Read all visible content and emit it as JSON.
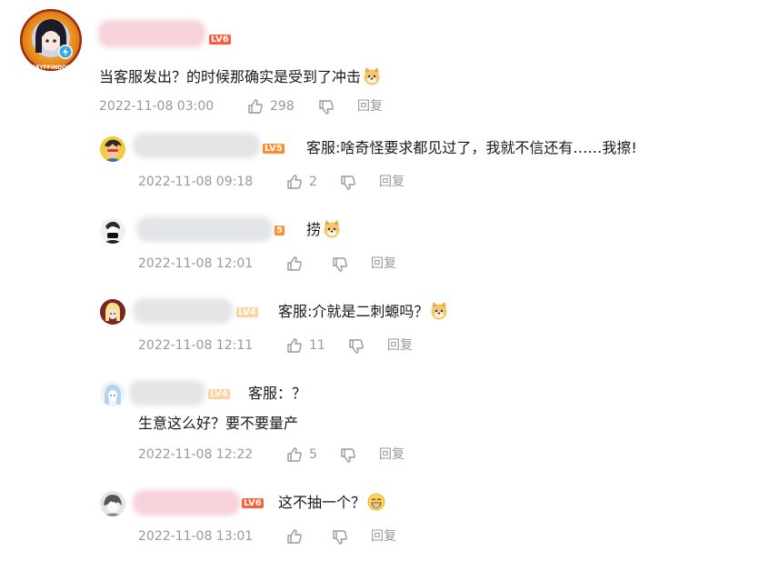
{
  "main_comment": {
    "level_badge": "LV6",
    "badge_text": "GRYFFINDOR",
    "text": "当客服发出？的时候那确实是受到了冲击",
    "emoji": "doge-emoji",
    "time": "2022-11-08 03:00",
    "likes": "298",
    "reply_label": "回复"
  },
  "replies": [
    {
      "level_badge": "LV5",
      "text": "客服:啥奇怪要求都见过了，我就不信还有……我擦!",
      "text2": "",
      "emoji": "",
      "time": "2022-11-08 09:18",
      "likes": "2",
      "reply_label": "回复"
    },
    {
      "level_badge": "5",
      "text": "捞",
      "text2": "",
      "emoji": "doge-emoji",
      "time": "2022-11-08 12:01",
      "likes": "",
      "reply_label": "回复"
    },
    {
      "level_badge": "LV4",
      "text": "客服:介就是二刺螈吗？",
      "text2": "",
      "emoji": "doge-emoji",
      "time": "2022-11-08 12:11",
      "likes": "11",
      "reply_label": "回复"
    },
    {
      "level_badge": "LV4",
      "text": "客服：？",
      "text2": "生意这么好？要不要量产",
      "emoji": "",
      "time": "2022-11-08 12:22",
      "likes": "5",
      "reply_label": "回复"
    },
    {
      "level_badge": "LV6",
      "text": "这不抽一个？",
      "text2": "",
      "emoji": "grin-emoji",
      "time": "2022-11-08 13:01",
      "likes": "",
      "reply_label": "回复"
    }
  ],
  "colors": {
    "meta_gray": "#9499a0",
    "lv6_red": "#ff6c00",
    "lv5_orange": "#ff8b2c",
    "lv4_yellow": "#ffd29e",
    "name_blur_pink": "#f9d7df",
    "name_blur_gray": "#e3e5e7"
  }
}
